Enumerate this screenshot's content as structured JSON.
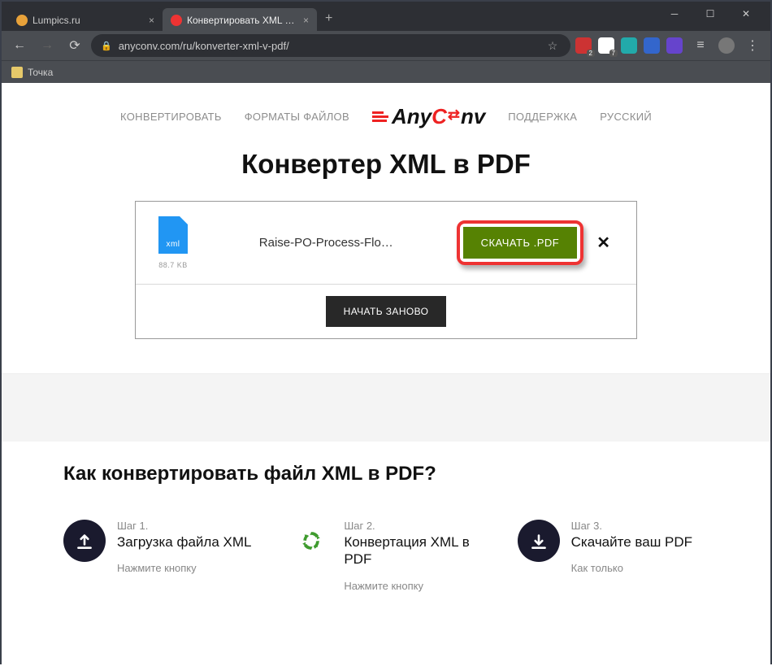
{
  "browser": {
    "tabs": [
      {
        "title": "Lumpics.ru",
        "favicon": "#e8a23a",
        "active": false
      },
      {
        "title": "Конвертировать XML в PDF онл",
        "favicon": "#e33",
        "active": true
      }
    ],
    "url": "anyconv.com/ru/konverter-xml-v-pdf/",
    "bookmark": "Точка",
    "ext_badges": [
      "2",
      "7"
    ]
  },
  "nav": {
    "convert": "КОНВЕРТИРОВАТЬ",
    "formats": "ФОРМАТЫ ФАЙЛОВ",
    "support": "ПОДДЕРЖКА",
    "lang": "РУССКИЙ"
  },
  "logo": {
    "any": "Any",
    "c": "C",
    "onv": "nv"
  },
  "heading": "Конвертер XML в PDF",
  "file": {
    "ext_label": "xml",
    "size": "88.7 KB",
    "name": "Raise-PO-Process-Flo…",
    "download": "СКАЧАТЬ .PDF"
  },
  "restart": "НАЧАТЬ ЗАНОВО",
  "howto": {
    "title": "Как конвертировать файл XML в PDF?",
    "steps": [
      {
        "num": "Шаг 1.",
        "title": "Загрузка файла XML",
        "desc": "Нажмите кнопку"
      },
      {
        "num": "Шаг 2.",
        "title": "Конвертация XML в PDF",
        "desc": "Нажмите кнопку"
      },
      {
        "num": "Шаг 3.",
        "title": "Скачайте ваш PDF",
        "desc": "Как только"
      }
    ]
  }
}
